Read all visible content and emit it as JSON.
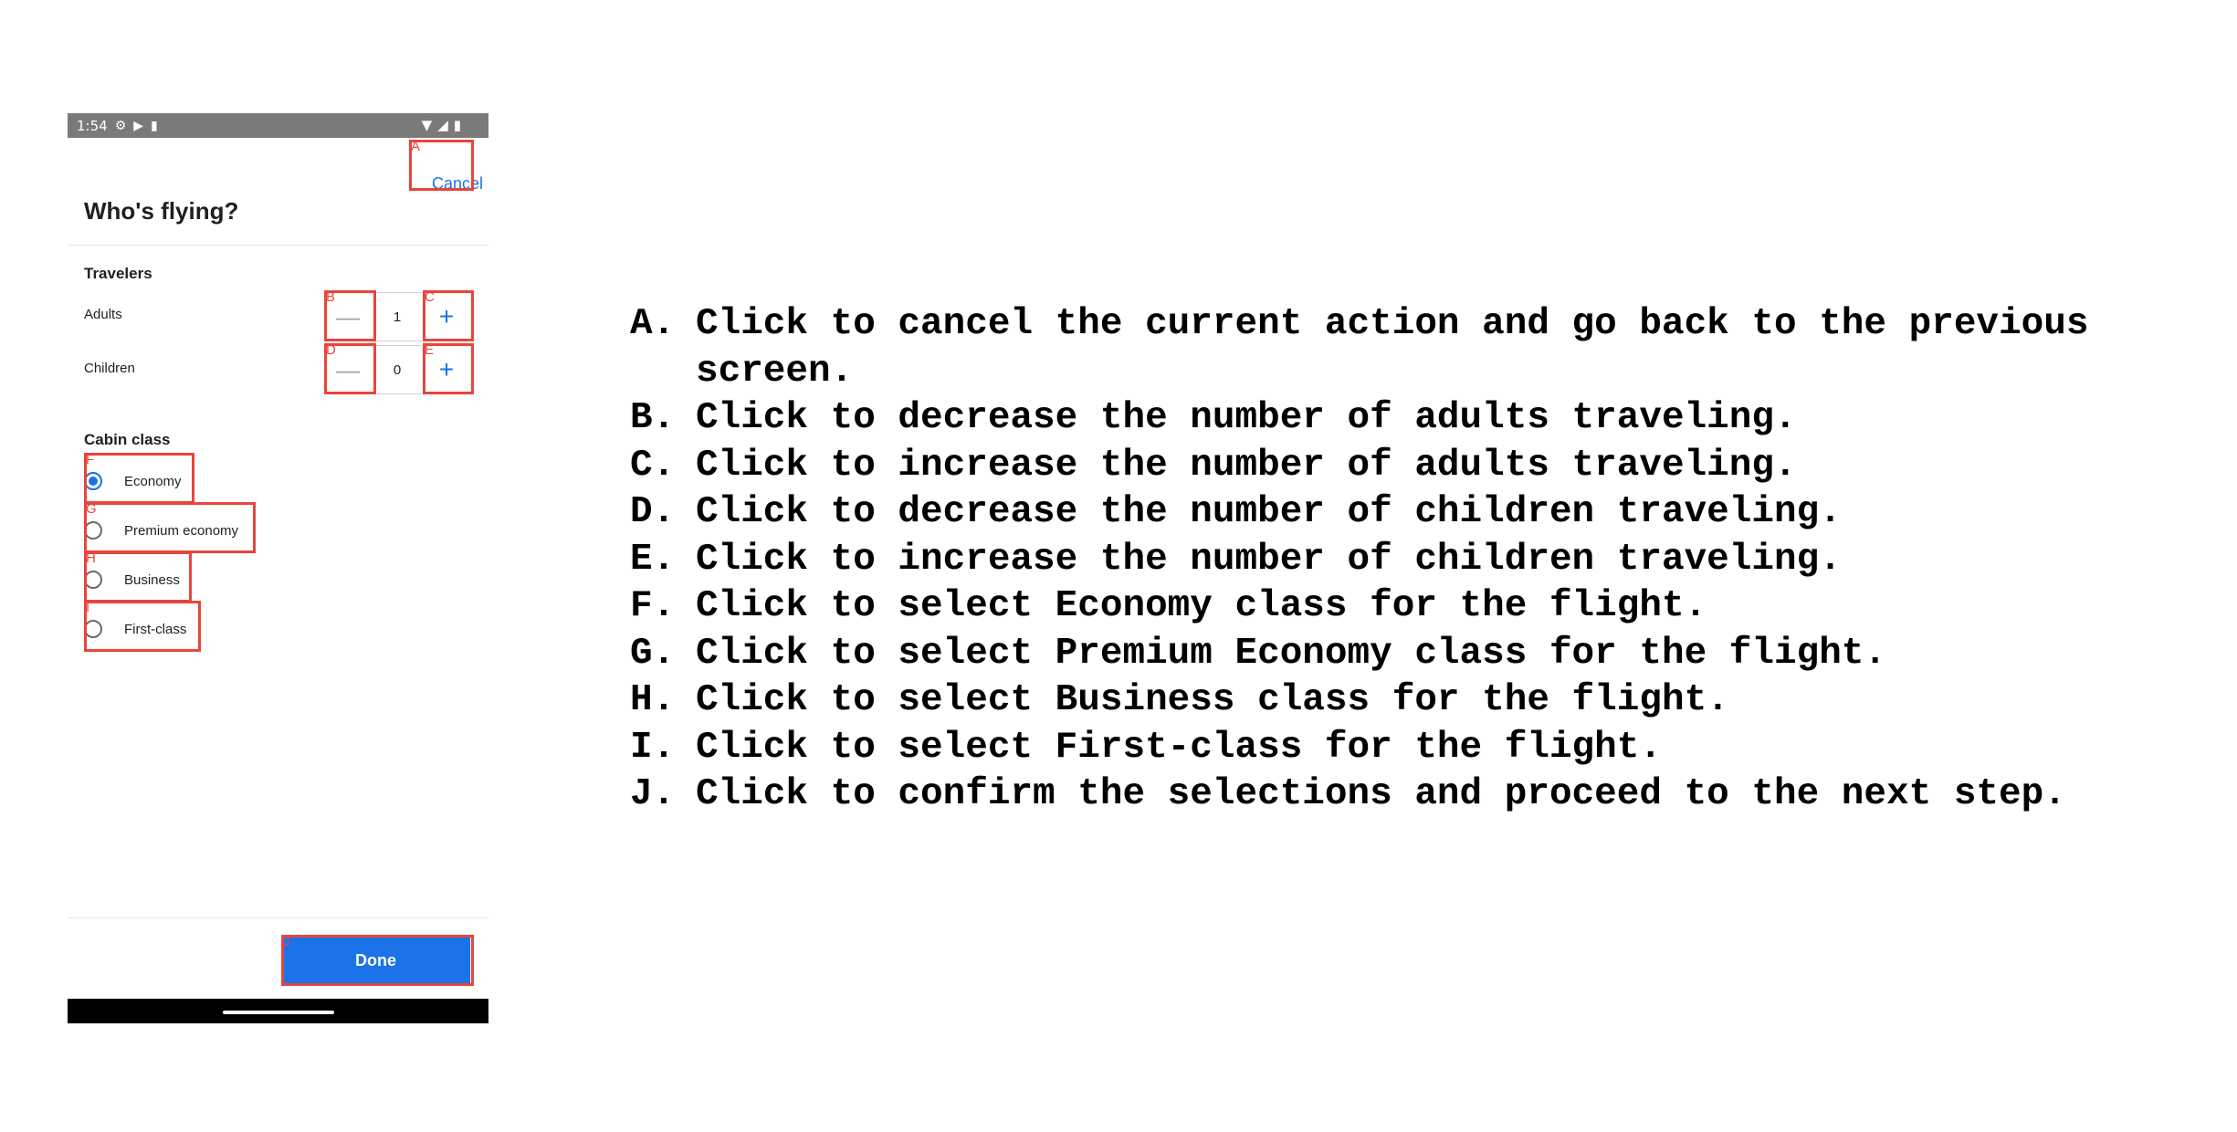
{
  "status_bar": {
    "time": "1:54",
    "left_icons": [
      "gear-icon",
      "play-icon",
      "sd-card-icon"
    ],
    "right_icons": [
      "wifi-icon",
      "signal-icon",
      "battery-icon"
    ]
  },
  "header": {
    "cancel_label": "Cancel",
    "title": "Who's flying?"
  },
  "travelers": {
    "section_label": "Travelers",
    "rows": [
      {
        "label": "Adults",
        "value": "1",
        "minus": "—",
        "plus": "+"
      },
      {
        "label": "Children",
        "value": "0",
        "minus": "—",
        "plus": "+"
      }
    ]
  },
  "cabin": {
    "section_label": "Cabin class",
    "options": [
      {
        "label": "Economy",
        "selected": true
      },
      {
        "label": "Premium economy",
        "selected": false
      },
      {
        "label": "Business",
        "selected": false
      },
      {
        "label": "First-class",
        "selected": false
      }
    ]
  },
  "footer": {
    "done_label": "Done"
  },
  "markers": {
    "a": "A",
    "b": "B",
    "c": "C",
    "d": "D",
    "e": "E",
    "f": "F",
    "g": "G",
    "h": "H",
    "i": "I",
    "j": "J"
  },
  "colors": {
    "accent": "#1a73e8",
    "marker": "#e8453c",
    "status_bar": "#7a7a7a"
  },
  "instructions": [
    {
      "letter": "A.",
      "text": "Click to cancel the current action and go back to the previous screen."
    },
    {
      "letter": "B.",
      "text": "Click to decrease the number of adults traveling."
    },
    {
      "letter": "C.",
      "text": "Click to increase the number of adults traveling."
    },
    {
      "letter": "D.",
      "text": "Click to decrease the number of children traveling."
    },
    {
      "letter": "E.",
      "text": "Click to increase the number of children traveling."
    },
    {
      "letter": "F.",
      "text": "Click to select Economy class for the flight."
    },
    {
      "letter": "G.",
      "text": "Click to select Premium Economy class for the flight."
    },
    {
      "letter": "H.",
      "text": "Click to select Business class for the flight."
    },
    {
      "letter": "I.",
      "text": "Click to select First-class for the flight."
    },
    {
      "letter": "J.",
      "text": "Click to confirm the selections and proceed to the next step."
    }
  ]
}
